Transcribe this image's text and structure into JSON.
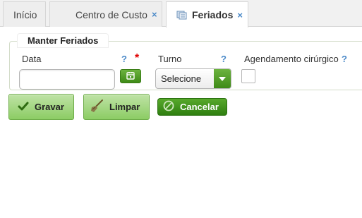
{
  "tabs": [
    {
      "label": "Início"
    },
    {
      "label": "Centro de Custo",
      "close": "×"
    },
    {
      "label": "Feriados",
      "close": "×",
      "active": true
    }
  ],
  "form": {
    "legend": "Manter Feriados",
    "data": {
      "label": "Data",
      "help": "?",
      "required": "*",
      "value": ""
    },
    "turno": {
      "label": "Turno",
      "help": "?",
      "selected": "Selecione"
    },
    "agendamento": {
      "label": "Agendamento cirúrgico",
      "help": "?",
      "checked": false
    }
  },
  "buttons": {
    "gravar": "Gravar",
    "limpar": "Limpar",
    "cancelar": "Cancelar"
  },
  "colors": {
    "accent_green": "#3e8a16",
    "help_blue": "#4a89c8",
    "required_red": "#e00000"
  }
}
